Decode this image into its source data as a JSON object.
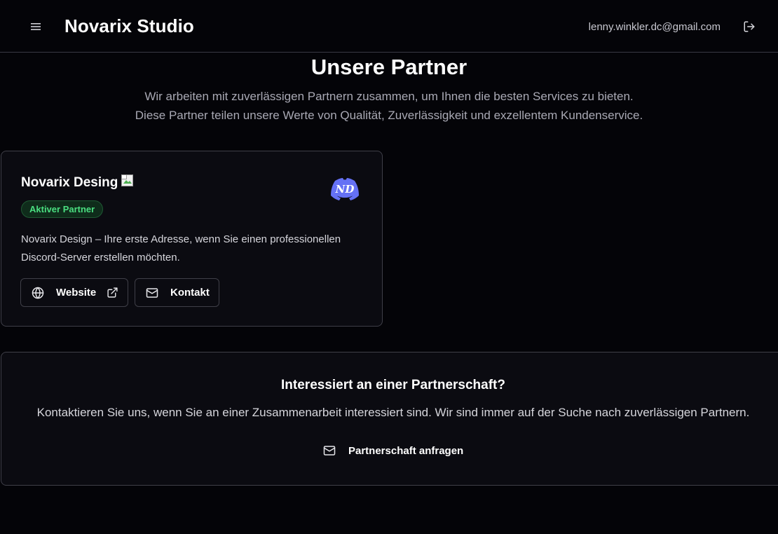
{
  "header": {
    "app_title": "Novarix Studio",
    "user_email": "lenny.winkler.dc@gmail.com",
    "menu_icon": "menu-icon",
    "logout_icon": "logout-icon"
  },
  "hero": {
    "title": "Unsere Partner",
    "subtitle_line1": "Wir arbeiten mit zuverlässigen Partnern zusammen, um Ihnen die besten Services zu bieten.",
    "subtitle_line2": "Diese Partner teilen unsere Werte von Qualität, Zuverlässigkeit und exzellentem Kundenservice."
  },
  "partner": {
    "name": "Novarix Desing",
    "badge": "Aktiver Partner",
    "description": "Novarix Design – Ihre erste Adresse, wenn Sie einen professionellen Discord-Server erstellen möchten.",
    "website_label": "Website",
    "contact_label": "Kontakt",
    "logo_text": "ND"
  },
  "partnership": {
    "title": "Interessiert an einer Partnerschaft?",
    "text": "Kontaktieren Sie uns, wenn Sie an einer Zusammenarbeit interessiert sind. Wir sind immer auf der Suche nach zuverlässigen Partnern.",
    "button_label": "Partnerschaft anfragen"
  },
  "colors": {
    "background": "#040408",
    "card": "#0b0b11",
    "border": "#3f3f48",
    "badge_text": "#4ade80",
    "discord_blue": "#5865f2"
  }
}
